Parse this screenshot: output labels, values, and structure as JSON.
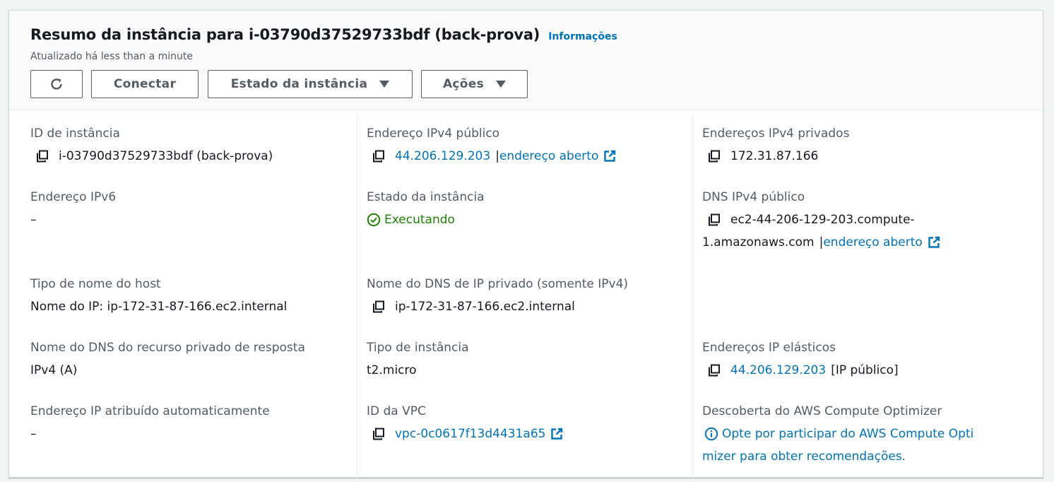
{
  "header": {
    "title": "Resumo da instância para i-03790d37529733bdf (back-prova)",
    "info_link": "Informações",
    "updated": "Atualizado há less than a minute",
    "buttons": {
      "refresh_icon": "refresh-icon",
      "connect": "Conectar",
      "instance_state": "Estado da instância",
      "actions": "Ações"
    }
  },
  "details": {
    "col1": {
      "instance_id": {
        "label": "ID de instância",
        "value": "i-03790d37529733bdf (back-prova)"
      },
      "ipv6": {
        "label": "Endereço IPv6",
        "value": "–"
      },
      "hostname_type": {
        "label": "Tipo de nome do host",
        "value": "Nome do IP: ip-172-31-87-166.ec2.internal"
      },
      "resource_dns": {
        "label": "Nome do DNS do recurso privado de resposta",
        "value": "IPv4 (A)"
      },
      "auto_ip": {
        "label": "Endereço IP atribuído automaticamente",
        "value": "–"
      }
    },
    "col2": {
      "public_ipv4": {
        "label": "Endereço IPv4 público",
        "value": "44.206.129.203",
        "separator": "|",
        "open_link": "endereço aberto"
      },
      "state": {
        "label": "Estado da instância",
        "value": "Executando"
      },
      "private_dns": {
        "label": "Nome do DNS de IP privado (somente IPv4)",
        "value": "ip-172-31-87-166.ec2.internal"
      },
      "instance_type": {
        "label": "Tipo de instância",
        "value": "t2.micro"
      },
      "vpc_id": {
        "label": "ID da VPC",
        "value": "vpc-0c0617f13d4431a65"
      }
    },
    "col3": {
      "private_ipv4": {
        "label": "Endereços IPv4 privados",
        "value": "172.31.87.166"
      },
      "public_dns": {
        "label": "DNS IPv4 público",
        "value_line1": "ec2-44-206-129-203.compute-",
        "value_line2": "1.amazonaws.com",
        "separator": "|",
        "open_link": "endereço aberto"
      },
      "elastic_ip": {
        "label": "Endereços IP elásticos",
        "value": "44.206.129.203",
        "suffix": "[IP público]"
      },
      "compute_optimizer": {
        "label": "Descoberta do AWS Compute Optimizer",
        "line1": "Opte por participar do AWS Compute Opti",
        "line2": "mizer para obter recomendações."
      }
    }
  },
  "colors": {
    "link": "#0073bb",
    "success": "#1d8102",
    "label": "#545b64",
    "text": "#16191f"
  }
}
